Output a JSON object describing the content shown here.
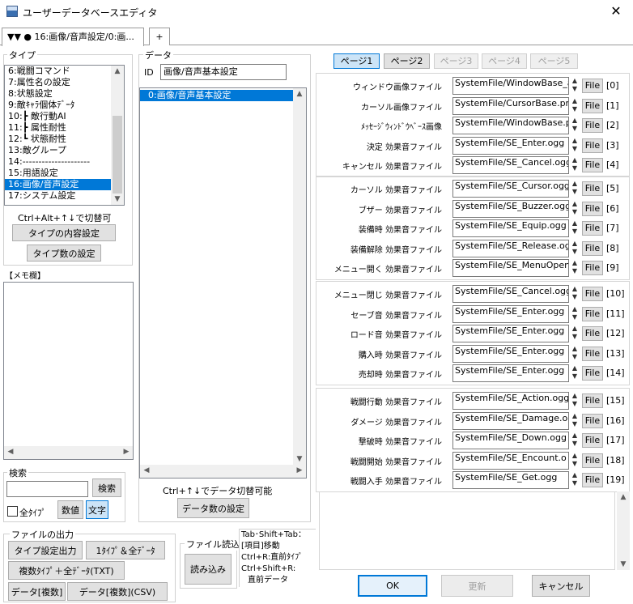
{
  "window": {
    "title": "ユーザーデータベースエディタ",
    "close_glyph": "✕",
    "icon": "database-app-icon"
  },
  "tabs": [
    {
      "label": "▼▼ ● 16:画像/音声設定/0:画..."
    },
    {
      "label": "+"
    }
  ],
  "type_group": {
    "label": "タイプ",
    "items": [
      "6:戦闘コマンド",
      "7:属性名の設定",
      "8:状態設定",
      "9:敵ｷｬﾗ個体ﾃﾞｰﾀ",
      "10:┣ 敵行動AI",
      "11:┣ 属性耐性",
      "12:┗ 状態耐性",
      "13:敵グループ",
      "14:---------------------",
      "15:用語設定",
      "16:画像/音声設定",
      "17:システム設定"
    ],
    "selected_index": 10,
    "hint": "Ctrl+Alt+↑↓で切替可",
    "content_button": "タイプの内容設定",
    "count_button": "タイプ数の設定"
  },
  "memo": {
    "label": "【メモ欄】"
  },
  "search": {
    "label": "検索",
    "value": "",
    "button": "検索",
    "all_types_label": "全ﾀｲﾌﾟ",
    "all_types_checked": false,
    "numeric_button": "数値",
    "text_button": "文字"
  },
  "file_output": {
    "label": "ファイルの出力",
    "type_settings_button": "タイプ設定出力",
    "one_type_all_data_button": "1ﾀｲﾌﾟ＆全ﾃﾞｰﾀ",
    "multi_type_button": "複数ﾀｲﾌﾟ＋全ﾃﾞｰﾀ(TXT)",
    "data_multi_button": "データ[複数]",
    "data_multi_csv_button": "データ[複数](CSV)"
  },
  "file_read": {
    "label": "ファイル読込",
    "button": "読み込み"
  },
  "help_text": {
    "line1": "Tab･Shift+Tab：",
    "line2": "[項目]移動",
    "line3": "Ctrl+R:直前ﾀｲﾌﾟ",
    "line4": "Ctrl+Shift+R:",
    "line5": "直前データ"
  },
  "data_group": {
    "label": "データ",
    "id_label": "ID",
    "name_value": "画像/音声基本設定",
    "items": [
      "0:画像/音声基本設定"
    ],
    "selected_index": 0,
    "hint": "Ctrl+↑↓でデータ切替可能",
    "count_button": "データ数の設定"
  },
  "pages": [
    {
      "label": "ページ1",
      "state": "active"
    },
    {
      "label": "ページ2",
      "state": "normal"
    },
    {
      "label": "ページ3",
      "state": "disabled"
    },
    {
      "label": "ページ4",
      "state": "disabled"
    },
    {
      "label": "ページ5",
      "state": "disabled"
    }
  ],
  "file_button_label": "File",
  "field_panels": [
    [
      {
        "label": "ウィンドウ画像ファイル",
        "value": "SystemFile/WindowBase_a",
        "index": "[0]"
      },
      {
        "label": "カーソル画像ファイル",
        "value": "SystemFile/CursorBase.pn",
        "index": "[1]"
      },
      {
        "label": "ﾒｯｾｰｼﾞｳｨﾝﾄﾞｳﾍﾞｰｽ画像",
        "value": "SystemFile/WindowBase.p",
        "index": "[2]"
      },
      {
        "label": "決定 効果音ファイル",
        "value": "SystemFile/SE_Enter.ogg",
        "index": "[3]"
      },
      {
        "label": "キャンセル 効果音ファイル",
        "value": "SystemFile/SE_Cancel.ogg",
        "index": "[4]"
      }
    ],
    [
      {
        "label": "カーソル 効果音ファイル",
        "value": "SystemFile/SE_Cursor.ogg",
        "index": "[5]"
      },
      {
        "label": "ブザー 効果音ファイル",
        "value": "SystemFile/SE_Buzzer.ogg",
        "index": "[6]"
      },
      {
        "label": "装備時 効果音ファイル",
        "value": "SystemFile/SE_Equip.ogg",
        "index": "[7]"
      },
      {
        "label": "装備解除 効果音ファイル",
        "value": "SystemFile/SE_Release.og",
        "index": "[8]"
      },
      {
        "label": "メニュー開く 効果音ファイル",
        "value": "SystemFile/SE_MenuOpen",
        "index": "[9]"
      }
    ],
    [
      {
        "label": "メニュー閉じ 効果音ファイル",
        "value": "SystemFile/SE_Cancel.ogg",
        "index": "[10]"
      },
      {
        "label": "セーブ音 効果音ファイル",
        "value": "SystemFile/SE_Enter.ogg",
        "index": "[11]"
      },
      {
        "label": "ロード音 効果音ファイル",
        "value": "SystemFile/SE_Enter.ogg",
        "index": "[12]"
      },
      {
        "label": "購入時 効果音ファイル",
        "value": "SystemFile/SE_Enter.ogg",
        "index": "[13]"
      },
      {
        "label": "売却時 効果音ファイル",
        "value": "SystemFile/SE_Enter.ogg",
        "index": "[14]"
      }
    ],
    [
      {
        "label": "戦闘行動 効果音ファイル",
        "value": "SystemFile/SE_Action.ogg",
        "index": "[15]"
      },
      {
        "label": "ダメージ 効果音ファイル",
        "value": "SystemFile/SE_Damage.og",
        "index": "[16]"
      },
      {
        "label": "撃破時 効果音ファイル",
        "value": "SystemFile/SE_Down.ogg",
        "index": "[17]"
      },
      {
        "label": "戦闘開始 効果音ファイル",
        "value": "SystemFile/SE_Encount.o",
        "index": "[18]"
      },
      {
        "label": "戦闘入手 効果音ファイル",
        "value": "SystemFile/SE_Get.ogg",
        "index": "[19]"
      }
    ]
  ],
  "footer": {
    "ok": "OK",
    "update": "更新",
    "cancel": "キャンセル"
  },
  "colors": {
    "selection": "#0078d7",
    "button_face": "#e1e1e1",
    "active_page": "#cce4f7"
  }
}
